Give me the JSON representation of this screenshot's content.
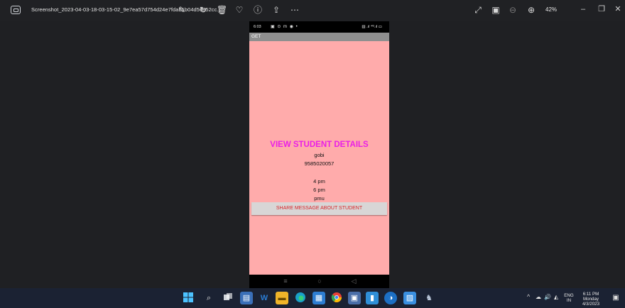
{
  "window": {
    "title": "Screenshot_2023-04-03-18-03-15-02_9e7ea57d754d24e7fdab1b04d56852cc.j...",
    "zoom": "42%",
    "toolbar_icons": [
      "edit-icon",
      "rotate-icon",
      "delete-icon",
      "favorite-icon",
      "info-icon",
      "share-icon",
      "more-icon"
    ],
    "right_icons": [
      "fullscreen-icon",
      "slideshow-icon",
      "zoom-out-icon",
      "zoom-in-icon"
    ],
    "controls": {
      "minimize": "–",
      "maximize": "❐",
      "close": "✕"
    }
  },
  "phone": {
    "status_time": "6:03",
    "status_icons": "▣ ⊙ m ◉ •",
    "status_right": "▥ .ıl ⁴ᴳ.ıl ▭",
    "action_title": "GET",
    "heading": "VIEW STUDENT DETAILS",
    "name": "gobi",
    "phone_number": "9585020057",
    "from_time": "4 pm",
    "to_time": "6 pm",
    "location": "pmu",
    "share_button": "SHARE MESSAGE ABOUT STUDENT",
    "nav": {
      "recents": "≡",
      "home": "○",
      "back": "◁"
    }
  },
  "taskbar": {
    "apps": [
      "windows-start",
      "search",
      "task-view",
      "widgets",
      "word",
      "file-explorer",
      "edge",
      "store",
      "chrome",
      "app-generic",
      "notepad",
      "app-blue",
      "photos",
      "game"
    ],
    "tray": {
      "language": "ENG",
      "region": "IN"
    },
    "clock": {
      "time": "6:11 PM",
      "day": "Monday",
      "date": "4/3/2023"
    }
  }
}
